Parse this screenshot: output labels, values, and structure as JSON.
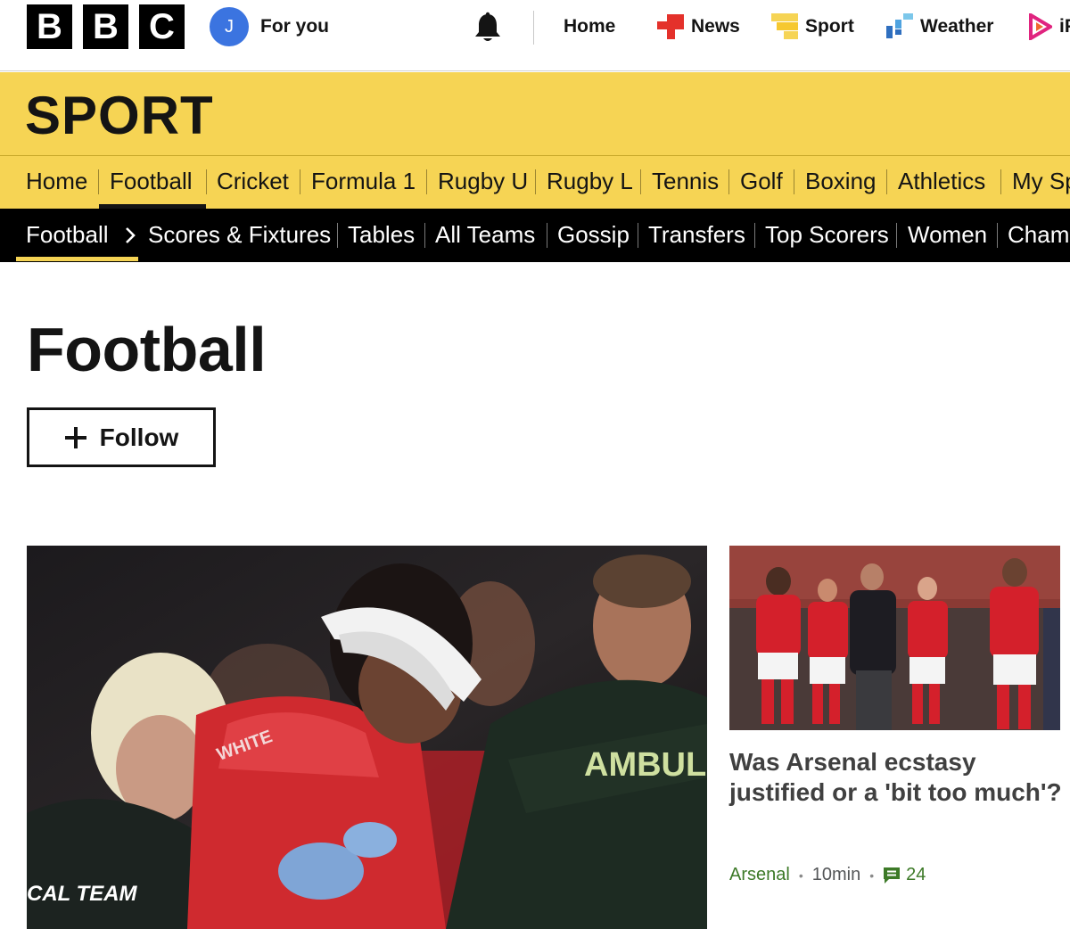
{
  "brand": {
    "letters": [
      "B",
      "B",
      "C"
    ]
  },
  "account": {
    "avatar_initial": "J",
    "label": "For you"
  },
  "global_nav": [
    {
      "label": "Home",
      "icon": "none"
    },
    {
      "label": "News",
      "icon": "news-icon"
    },
    {
      "label": "Sport",
      "icon": "sport-icon"
    },
    {
      "label": "Weather",
      "icon": "weather-icon"
    },
    {
      "label": "iPlayer",
      "icon": "iplayer-icon"
    }
  ],
  "section": {
    "title": "SPORT"
  },
  "sport_nav": [
    {
      "label": "Home"
    },
    {
      "label": "Football",
      "active": true
    },
    {
      "label": "Cricket"
    },
    {
      "label": "Formula 1"
    },
    {
      "label": "Rugby U"
    },
    {
      "label": "Rugby L"
    },
    {
      "label": "Tennis"
    },
    {
      "label": "Golf"
    },
    {
      "label": "Boxing"
    },
    {
      "label": "Athletics"
    },
    {
      "label": "My Sport"
    }
  ],
  "football_nav": [
    {
      "label": "Football",
      "active": true
    },
    {
      "label": "Scores & Fixtures"
    },
    {
      "label": "Tables"
    },
    {
      "label": "All Teams"
    },
    {
      "label": "Gossip"
    },
    {
      "label": "Transfers"
    },
    {
      "label": "Top Scorers"
    },
    {
      "label": "Women"
    },
    {
      "label": "Champions League"
    }
  ],
  "page": {
    "title": "Football",
    "follow_label": "Follow"
  },
  "lead_story": {
    "image_text": {
      "vest": "AMBULA",
      "team": "CAL TEAM",
      "shirt": "WHITE"
    }
  },
  "second_story": {
    "headline": "Was Arsenal ecstasy justified or a 'bit too much'?",
    "topic": "Arsenal",
    "time": "10min",
    "comments": "24"
  },
  "colors": {
    "sport_yellow": "#f6d454",
    "subnav_black": "#000000",
    "link_green": "#3d7a28",
    "avatar_blue": "#3b74e0",
    "news_red": "#e4312b",
    "arsenal_red": "#d4202b"
  }
}
